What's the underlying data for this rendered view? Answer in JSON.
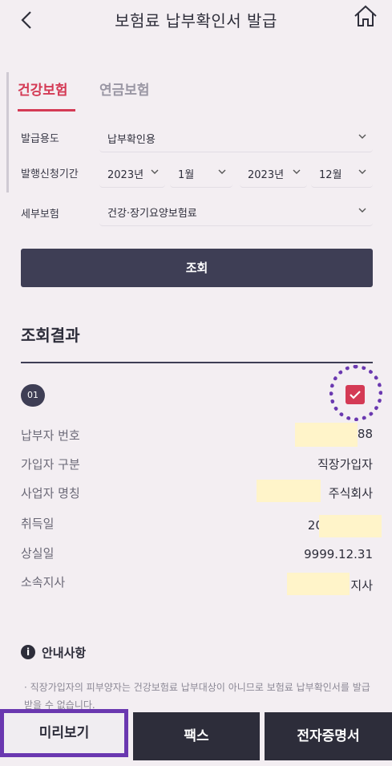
{
  "header": {
    "title": "보험료 납부확인서 발급"
  },
  "tabs": [
    {
      "label": "건강보험",
      "active": true
    },
    {
      "label": "연금보험",
      "active": false
    }
  ],
  "form": {
    "purpose": {
      "label": "발급용도",
      "value": "납부확인용"
    },
    "period": {
      "label": "발행신청기간",
      "start_year": "2023년",
      "start_month": "1월",
      "end_year": "2023년",
      "end_month": "12월"
    },
    "detail": {
      "label": "세부보험",
      "value": "건강·장기요양보험료"
    }
  },
  "query_button": "조회",
  "result": {
    "title": "조회결과",
    "item_number": "01",
    "rows": [
      {
        "label": "납부자 번호",
        "value": "80 88"
      },
      {
        "label": "가입자 구분",
        "value": "직장가입자"
      },
      {
        "label": "사업자 명칭",
        "value": "주식회사"
      },
      {
        "label": "취득일",
        "value": "20"
      },
      {
        "label": "상실일",
        "value": "9999.12.31"
      },
      {
        "label": "소속지사",
        "value": "지사"
      }
    ]
  },
  "notice": {
    "title": "안내사항",
    "text": "· 직장가입자의 피부양자는 건강보험료 납부대상이 아니므로 보험료 납부확인서를 발급받을 수 없습니다."
  },
  "bottom_buttons": {
    "preview": "미리보기",
    "fax": "팩스",
    "esign": "전자증명서"
  },
  "colors": {
    "accent": "#d43a55",
    "dark": "#3e3e55",
    "annotation": "#6a38b0",
    "mask": "#fff4c9"
  }
}
